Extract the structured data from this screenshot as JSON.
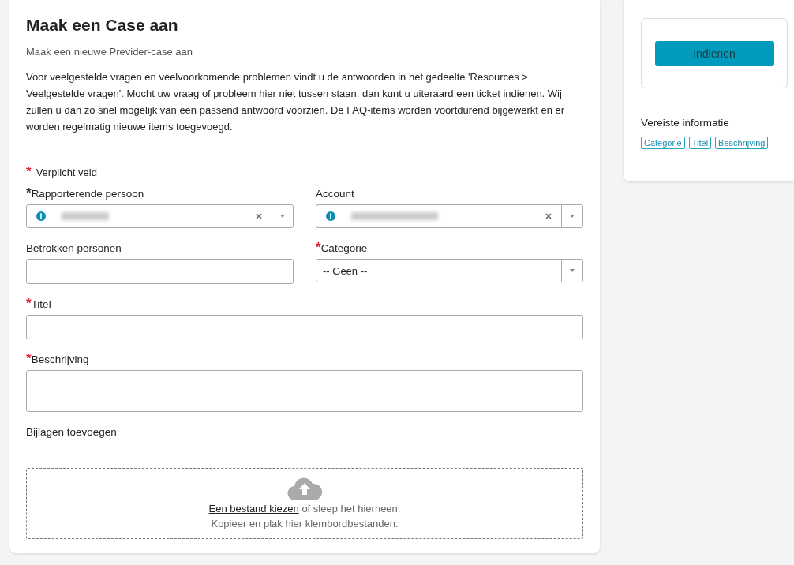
{
  "form": {
    "title": "Maak een Case aan",
    "subtitle": "Maak een nieuwe Previder-case aan",
    "intro": "Voor veelgestelde vragen en veelvoorkomende problemen vindt u de antwoorden in het gedeelte 'Resources > Veelgestelde vragen'. Mocht uw vraag of probleem hier niet tussen staan, dan kunt u uiteraard een ticket indienen. Wij zullen u dan zo snel mogelijk van een passend antwoord voorzien. De FAQ-items worden voortdurend bijgewerkt en er worden regelmatig nieuwe items toegevoegd.",
    "required_note": "Verplicht veld",
    "required_note_mark": "*",
    "rows": [
      {
        "fields": [
          {
            "kind": "lookup",
            "label": "Rapporterende persoon",
            "required_mark": "*",
            "color": "#333333"
          },
          {
            "kind": "lookup",
            "label": "Account"
          }
        ]
      },
      {
        "fields": [
          {
            "kind": "text",
            "label": "Betrokken personen"
          },
          {
            "kind": "select",
            "label": "Categorie",
            "required_mark": "*",
            "color": "#e8192c",
            "value": "-- Geen --"
          }
        ]
      },
      {
        "fields": [
          {
            "kind": "text",
            "label": "Titel",
            "required_mark": "*",
            "color": "#e8192c"
          }
        ]
      },
      {
        "fields": [
          {
            "kind": "textarea",
            "label": "Beschrijving",
            "required_mark": "*",
            "color": "#e8192c"
          }
        ]
      }
    ],
    "attachments": {
      "label": "Bijlagen toevoegen",
      "link": "Een bestand kiezen",
      "link_suffix": "of sleep het hierheen.",
      "hint": "Kopieer en plak hier klembordbestanden."
    }
  },
  "sidebar": {
    "submit": "Indienen",
    "required_title": "Vereiste informatie",
    "required_tags": [
      "Categorie",
      "Titel",
      "Beschrijving"
    ]
  }
}
